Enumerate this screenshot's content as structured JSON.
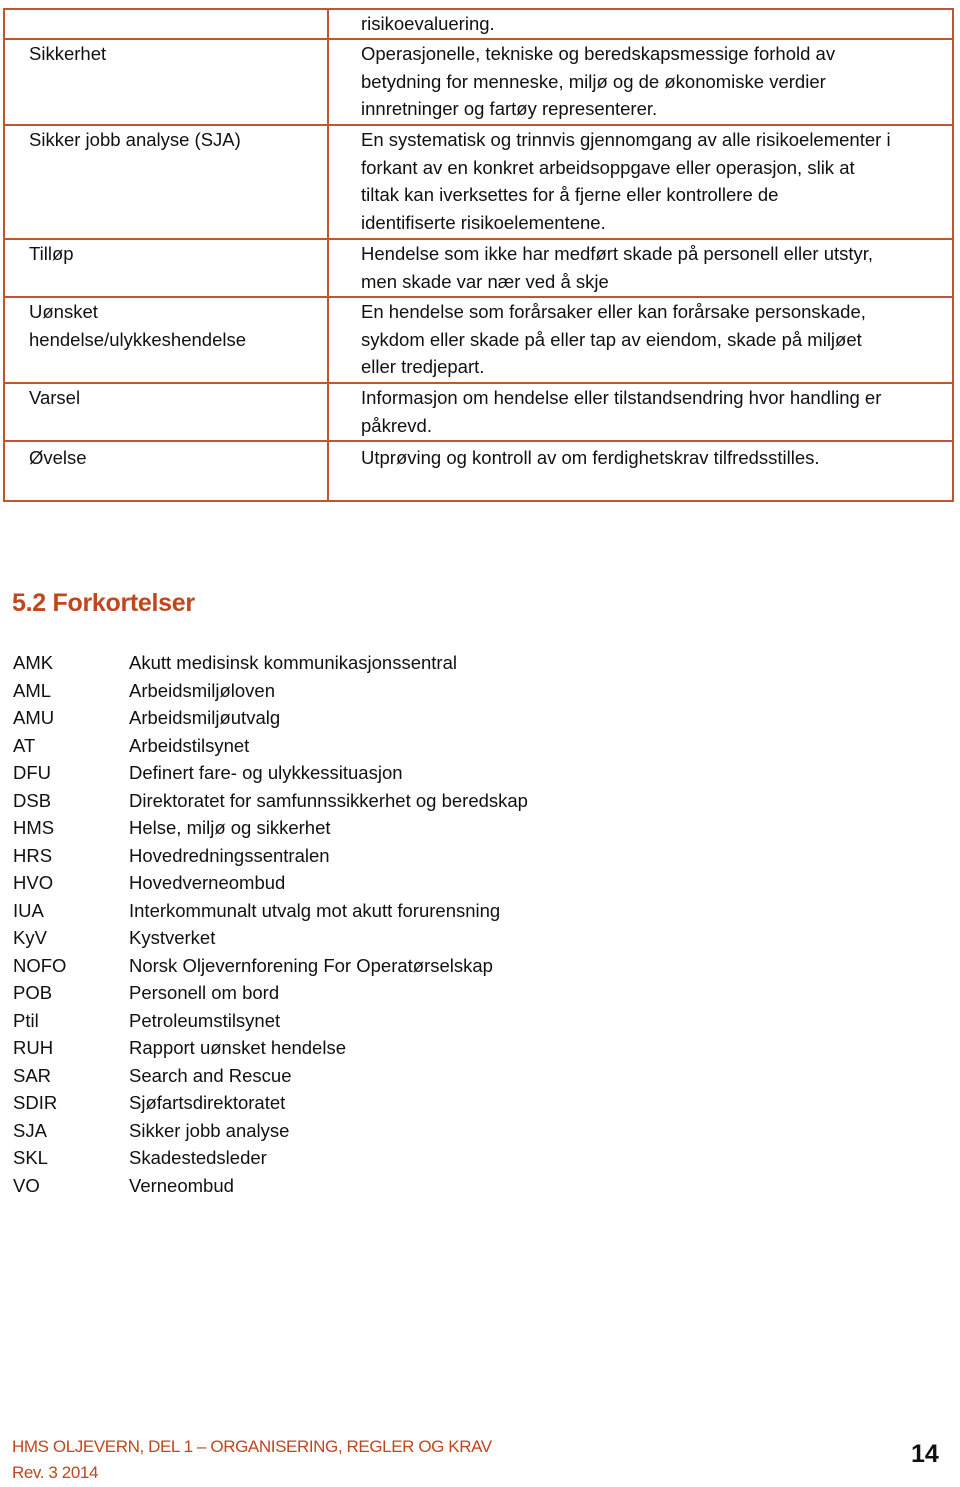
{
  "glossary_table": {
    "rows": [
      {
        "term": "",
        "definition_lines": [
          "risikoevaluering."
        ]
      },
      {
        "term": "Sikkerhet",
        "definition_lines": [
          "Operasjonelle, tekniske og beredskapsmessige forhold av",
          "betydning for menneske, miljø og de økonomiske verdier",
          "innretninger og fartøy representerer."
        ]
      },
      {
        "term": "Sikker jobb analyse (SJA)",
        "definition_lines": [
          "En systematisk og trinnvis gjennomgang av alle risikoelementer i",
          "forkant av en konkret arbeidsoppgave eller operasjon, slik at",
          "tiltak kan iverksettes for å fjerne eller kontrollere de",
          "identifiserte risikoelementene."
        ]
      },
      {
        "term": "Tilløp",
        "definition_lines": [
          "Hendelse som ikke har medført skade på personell eller utstyr,",
          "men skade var nær ved å skje"
        ]
      },
      {
        "term_lines": [
          "Uønsket",
          "hendelse/ulykkeshendelse"
        ],
        "definition_lines": [
          "En hendelse som forårsaker eller kan forårsake personskade,",
          "sykdom eller skade på eller tap av eiendom, skade på miljøet",
          "eller tredjepart."
        ]
      },
      {
        "term": "Varsel",
        "definition_lines": [
          "Informasjon om hendelse eller tilstandsendring hvor handling er",
          "påkrevd."
        ]
      },
      {
        "term": "Øvelse",
        "definition_lines": [
          "Utprøving og kontroll av om ferdighetskrav tilfredsstilles."
        ]
      }
    ]
  },
  "abbreviations": {
    "heading": "5.2 Forkortelser",
    "items": [
      {
        "code": "AMK",
        "description": "Akutt medisinsk kommunikasjonssentral"
      },
      {
        "code": "AML",
        "description": "Arbeidsmiljøloven"
      },
      {
        "code": "AMU",
        "description": "Arbeidsmiljøutvalg"
      },
      {
        "code": "AT",
        "description": "Arbeidstilsynet"
      },
      {
        "code": "DFU",
        "description": "Definert fare- og ulykkessituasjon"
      },
      {
        "code": "DSB",
        "description": "Direktoratet for samfunnssikkerhet og beredskap"
      },
      {
        "code": "HMS",
        "description": "Helse, miljø og sikkerhet"
      },
      {
        "code": "HRS",
        "description": "Hovedredningssentralen"
      },
      {
        "code": "HVO",
        "description": "Hovedverneombud"
      },
      {
        "code": "IUA",
        "description": "Interkommunalt utvalg mot akutt forurensning"
      },
      {
        "code": "KyV",
        "description": "Kystverket"
      },
      {
        "code": "NOFO",
        "description": "Norsk Oljevernforening For Operatørselskap"
      },
      {
        "code": "POB",
        "description": "Personell om bord"
      },
      {
        "code": "Ptil",
        "description": "Petroleumstilsynet"
      },
      {
        "code": "RUH",
        "description": "Rapport uønsket hendelse"
      },
      {
        "code": "SAR",
        "description": "Search and Rescue"
      },
      {
        "code": "SDIR",
        "description": "Sjøfartsdirektoratet"
      },
      {
        "code": "SJA",
        "description": "Sikker jobb analyse"
      },
      {
        "code": "SKL",
        "description": "Skadestedsleder"
      },
      {
        "code": "VO",
        "description": "Verneombud"
      }
    ]
  },
  "footer": {
    "title": "HMS OLJEVERN, DEL 1 – ORGANISERING, REGLER OG KRAV",
    "revision": "Rev. 3 2014",
    "page_number": "14"
  },
  "colors": {
    "accent": "#c0461e",
    "table_border": "#c0552e",
    "text": "#111111"
  }
}
